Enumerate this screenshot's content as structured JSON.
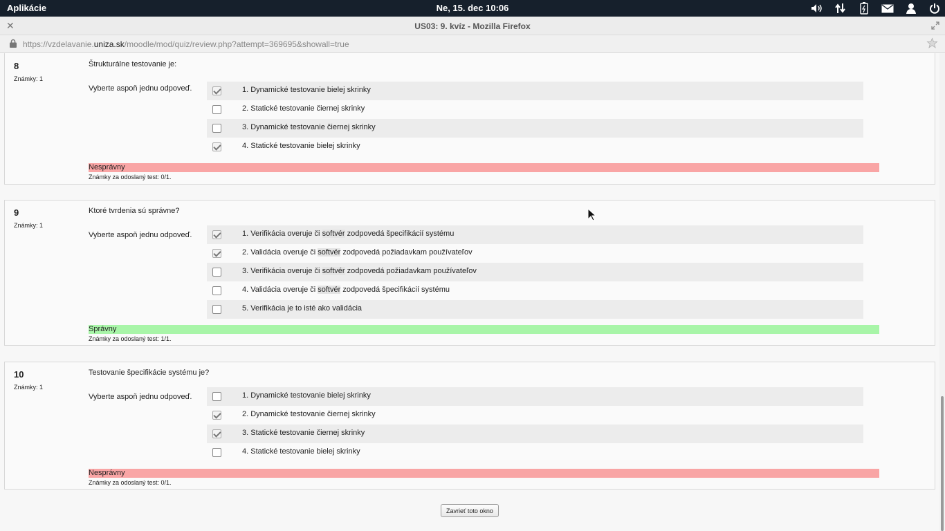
{
  "system_panel": {
    "apps_label": "Aplikácie",
    "clock": "Ne, 15. dec 10:06",
    "tray_icons": [
      "volume-icon",
      "network-icon",
      "battery-icon",
      "mail-icon",
      "user-icon",
      "power-icon"
    ]
  },
  "window": {
    "title": "US03: 9. kvíz - Mozilla Firefox",
    "url_prefix": "https://vzdelavanie.",
    "url_domain": "uniza.sk",
    "url_suffix": "/moodle/mod/quiz/review.php?attempt=369695&showall=true"
  },
  "questions": [
    {
      "number": "8",
      "grade": "Známky: 1",
      "text": "Štrukturálne testovanie je:",
      "prompt": "Vyberte aspoň jednu odpoveď.",
      "answers": [
        {
          "label": "1. Dynamické testovanie bielej skrinky",
          "checked": true
        },
        {
          "label": "2. Statické testovanie čiernej skrinky",
          "checked": false
        },
        {
          "label": "3. Dynamické testovanie čiernej skrinky",
          "checked": false
        },
        {
          "label": "4. Statické testovanie bielej skrinky",
          "checked": true
        }
      ],
      "outcome": "Nesprávny",
      "outcome_status": "incorrect",
      "mark": "Známky za odoslaný test: 0/1."
    },
    {
      "number": "9",
      "grade": "Známky: 1",
      "text": "Ktoré tvrdenia sú správne?",
      "prompt": "Vyberte aspoň jednu odpoveď.",
      "answers": [
        {
          "pre": "1. Verifikácia overuje či ",
          "hl": "softvér",
          "post": " zodpovedá špecifikácií systému",
          "checked": true
        },
        {
          "pre": "2. Validácia overuje či ",
          "hl": "softvér",
          "post": " zodpovedá požiadavkam používateľov",
          "checked": true
        },
        {
          "pre": "3. Verifikácia overuje či ",
          "hl": "softvér",
          "post": " zodpovedá požiadavkam používateľov",
          "checked": false
        },
        {
          "pre": "4. Validácia overuje či ",
          "hl": "softvér",
          "post": " zodpovedá špecifikácií systému",
          "checked": false
        },
        {
          "label": "5. Verifikácia je to isté ako validácia",
          "checked": false
        }
      ],
      "outcome": "Správny",
      "outcome_status": "correct",
      "mark": "Známky za odoslaný test: 1/1."
    },
    {
      "number": "10",
      "grade": "Známky: 1",
      "text": "Testovanie špecifikácie systému je?",
      "prompt": "Vyberte aspoň jednu odpoveď.",
      "answers": [
        {
          "label": "1. Dynamické testovanie bielej skrinky",
          "checked": false
        },
        {
          "label": "2. Dynamické testovanie čiernej skrinky",
          "checked": true
        },
        {
          "label": "3. Statické testovanie čiernej skrinky",
          "checked": true
        },
        {
          "label": "4. Statické testovanie bielej skrinky",
          "checked": false
        }
      ],
      "outcome": "Nesprávny",
      "outcome_status": "incorrect",
      "mark": "Známky za odoslaný test: 0/1."
    }
  ],
  "close_button_label": "Zavrieť toto okno"
}
